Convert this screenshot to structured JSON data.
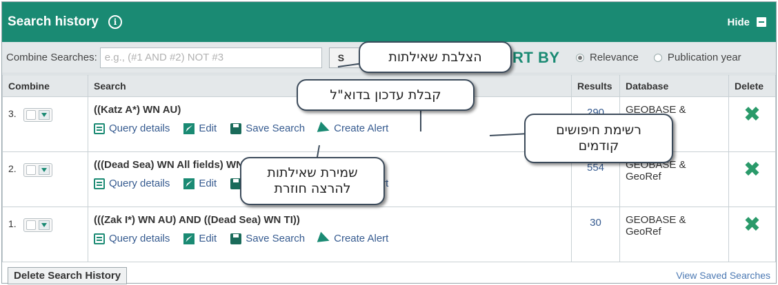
{
  "header": {
    "title": "Search history",
    "info_icon": "info-icon",
    "hide_label": "Hide"
  },
  "combine": {
    "label": "Combine Searches:",
    "placeholder": "e.g., (#1 AND #2) NOT #3",
    "go_label": "S",
    "sort_label": "RT BY",
    "sort_options": [
      {
        "label": "Relevance",
        "selected": true
      },
      {
        "label": "Publication year",
        "selected": false
      }
    ]
  },
  "table": {
    "headers": [
      "Combine",
      "Search",
      "Results",
      "Database",
      "Delete"
    ],
    "rows": [
      {
        "num": "3.",
        "query": "((Katz A*) WN AU)",
        "results": "290",
        "database": "GEOBASE & GeoRef"
      },
      {
        "num": "2.",
        "query": "(((Dead Sea) WN All fields) WN All fields))",
        "results": "554",
        "database": "GEOBASE & GeoRef"
      },
      {
        "num": "1.",
        "query": "(((Zak I*) WN AU) AND ((Dead Sea) WN TI))",
        "results": "30",
        "database": "GEOBASE & GeoRef"
      }
    ],
    "actions": {
      "query_details": "Query details",
      "edit": "Edit",
      "save_search": "Save Search",
      "create_alert": "Create Alert"
    }
  },
  "footer": {
    "delete_history": "Delete Search History",
    "view_saved": "View Saved Searches"
  },
  "callouts": {
    "combine": "הצלבת שאילתות",
    "alert": "קבלת עדכון בדוא\"ל",
    "history_line1": "רשימת חיפושים",
    "history_line2": "קודמים",
    "save_line1": "שמירת שאילתות",
    "save_line2": "להרצה חוזרת"
  },
  "colors": {
    "header_bg": "#1a8a73",
    "link": "#355a8f",
    "delete_icon": "#2a9a6a"
  }
}
